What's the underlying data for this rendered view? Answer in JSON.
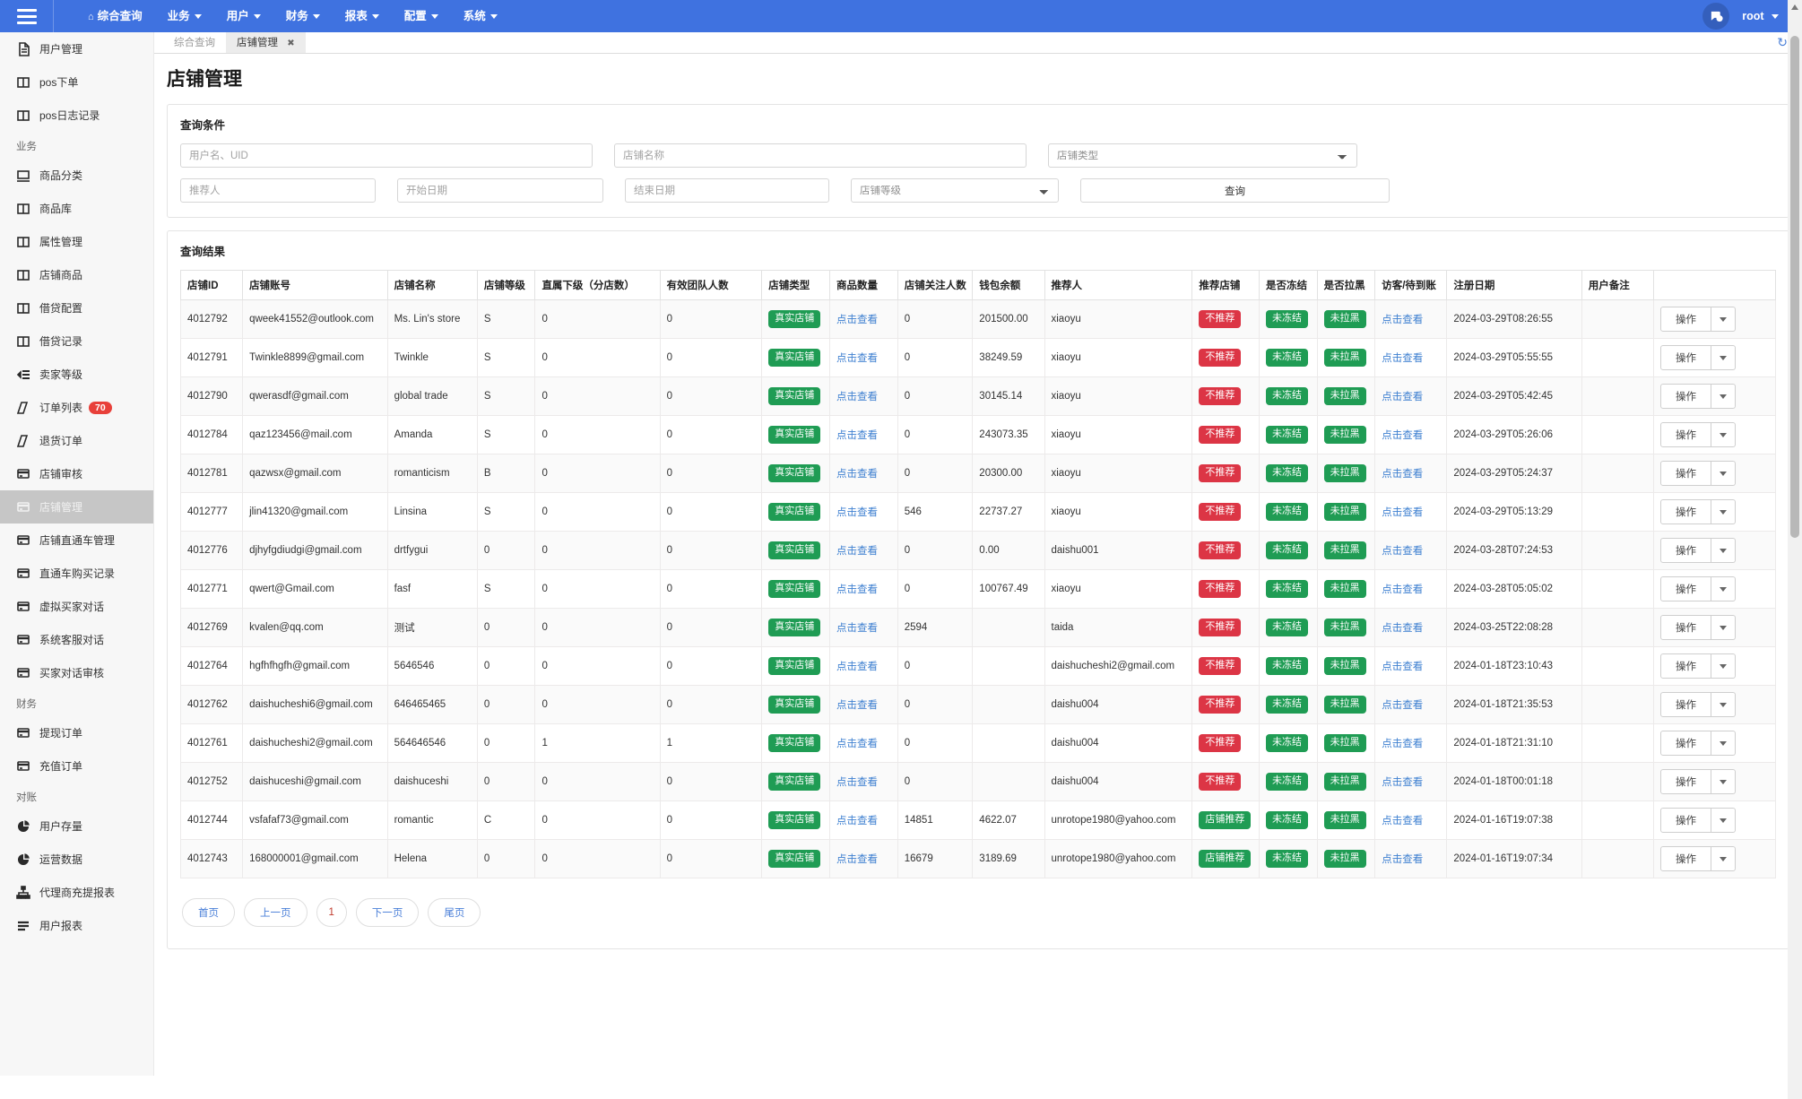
{
  "navbar": {
    "hamburger_icon": "hamburger-icon",
    "items": [
      {
        "label": "综合查询",
        "home": true,
        "caret": false
      },
      {
        "label": "业务",
        "home": false,
        "caret": true
      },
      {
        "label": "用户",
        "home": false,
        "caret": true
      },
      {
        "label": "财务",
        "home": false,
        "caret": true
      },
      {
        "label": "报表",
        "home": false,
        "caret": true
      },
      {
        "label": "配置",
        "home": false,
        "caret": true
      },
      {
        "label": "系统",
        "home": false,
        "caret": true
      }
    ],
    "chat_icon": "chat-bubble-icon",
    "user": "root",
    "brand_color": "#3f72e0"
  },
  "sidebar": {
    "items": [
      {
        "type": "item",
        "label": "用户管理",
        "icon": "document-icon",
        "badge": null,
        "active": false
      },
      {
        "type": "item",
        "label": "pos下单",
        "icon": "columns-icon",
        "badge": null,
        "active": false
      },
      {
        "type": "item",
        "label": "pos日志记录",
        "icon": "columns-icon",
        "badge": null,
        "active": false
      },
      {
        "type": "group",
        "label": "业务"
      },
      {
        "type": "item",
        "label": "商品分类",
        "icon": "monitor-icon",
        "badge": null,
        "active": false
      },
      {
        "type": "item",
        "label": "商品库",
        "icon": "columns-icon",
        "badge": null,
        "active": false
      },
      {
        "type": "item",
        "label": "属性管理",
        "icon": "columns-icon",
        "badge": null,
        "active": false
      },
      {
        "type": "item",
        "label": "店铺商品",
        "icon": "columns-icon",
        "badge": null,
        "active": false
      },
      {
        "type": "item",
        "label": "借贷配置",
        "icon": "columns-icon",
        "badge": null,
        "active": false
      },
      {
        "type": "item",
        "label": "借贷记录",
        "icon": "columns-icon",
        "badge": null,
        "active": false
      },
      {
        "type": "item",
        "label": "卖家等级",
        "icon": "list-icon",
        "badge": null,
        "active": false
      },
      {
        "type": "item",
        "label": "订单列表",
        "icon": "tag-icon",
        "badge": "70",
        "active": false
      },
      {
        "type": "item",
        "label": "退货订单",
        "icon": "tag-icon",
        "badge": null,
        "active": false
      },
      {
        "type": "item",
        "label": "店铺审核",
        "icon": "card-icon",
        "badge": null,
        "active": false
      },
      {
        "type": "item",
        "label": "店铺管理",
        "icon": "card-icon",
        "badge": null,
        "active": true
      },
      {
        "type": "item",
        "label": "店铺直通车管理",
        "icon": "card-icon",
        "badge": null,
        "active": false
      },
      {
        "type": "item",
        "label": "直通车购买记录",
        "icon": "card-icon",
        "badge": null,
        "active": false
      },
      {
        "type": "item",
        "label": "虚拟买家对话",
        "icon": "card-icon",
        "badge": null,
        "active": false
      },
      {
        "type": "item",
        "label": "系统客服对话",
        "icon": "card-icon",
        "badge": null,
        "active": false
      },
      {
        "type": "item",
        "label": "买家对话审核",
        "icon": "card-icon",
        "badge": null,
        "active": false
      },
      {
        "type": "group",
        "label": "财务"
      },
      {
        "type": "item",
        "label": "提现订单",
        "icon": "card-icon",
        "badge": null,
        "active": false
      },
      {
        "type": "item",
        "label": "充值订单",
        "icon": "card-icon",
        "badge": null,
        "active": false
      },
      {
        "type": "group",
        "label": "对账"
      },
      {
        "type": "item",
        "label": "用户存量",
        "icon": "pie-chart-icon",
        "badge": null,
        "active": false
      },
      {
        "type": "item",
        "label": "运营数据",
        "icon": "pie-chart-icon",
        "badge": null,
        "active": false
      },
      {
        "type": "item",
        "label": "代理商充提报表",
        "icon": "sitemap-icon",
        "badge": null,
        "active": false
      },
      {
        "type": "item",
        "label": "用户报表",
        "icon": "bars-icon",
        "badge": null,
        "active": false
      }
    ]
  },
  "tabs": {
    "inactive_label": "综合查询",
    "active_label": "店铺管理",
    "close_glyph": "✖",
    "refresh_icon": "refresh-icon"
  },
  "page": {
    "title": "店铺管理"
  },
  "filters": {
    "panel_title": "查询条件",
    "username_placeholder": "用户名、UID",
    "username_value": "",
    "shopname_placeholder": "店铺名称",
    "shopname_value": "",
    "shoptype_selected": "店铺类型",
    "shoptype_options": [
      "店铺类型"
    ],
    "referrer_placeholder": "推荐人",
    "referrer_value": "",
    "startdate_placeholder": "开始日期",
    "startdate_value": "",
    "enddate_placeholder": "结束日期",
    "enddate_value": "",
    "shoplevel_selected": "店铺等级",
    "shoplevel_options": [
      "店铺等级"
    ],
    "query_button": "查询"
  },
  "results": {
    "panel_title": "查询结果",
    "columns": [
      "店铺ID",
      "店铺账号",
      "店铺名称",
      "店铺等级",
      "直属下级（分店数）",
      "有效团队人数",
      "店铺类型",
      "商品数量",
      "店铺关注人数",
      "钱包余额",
      "推荐人",
      "推荐店铺",
      "是否冻结",
      "是否拉黑",
      "访客/待到账",
      "注册日期",
      "用户备注",
      ""
    ],
    "view_link_label": "点击查看",
    "op_button_label": "操作",
    "rows": [
      {
        "id": "4012792",
        "account": "qweek41552@outlook.com",
        "name": "Ms. Lin's store",
        "level": "S",
        "subs": "0",
        "team": "0",
        "type": "真实店铺",
        "goods": "点击查看",
        "followers": "0",
        "wallet": "201500.00",
        "referrer": "xiaoyu",
        "recommend": "不推荐",
        "recommend_style": "red",
        "frozen": "未冻结",
        "blacklist": "未拉黑",
        "visitor": "点击查看",
        "regdate": "2024-03-29T08:26:55",
        "note": ""
      },
      {
        "id": "4012791",
        "account": "Twinkle8899@gmail.com",
        "name": "Twinkle",
        "level": "S",
        "subs": "0",
        "team": "0",
        "type": "真实店铺",
        "goods": "点击查看",
        "followers": "0",
        "wallet": "38249.59",
        "referrer": "xiaoyu",
        "recommend": "不推荐",
        "recommend_style": "red",
        "frozen": "未冻结",
        "blacklist": "未拉黑",
        "visitor": "点击查看",
        "regdate": "2024-03-29T05:55:55",
        "note": ""
      },
      {
        "id": "4012790",
        "account": "qwerasdf@gmail.com",
        "name": "global trade",
        "level": "S",
        "subs": "0",
        "team": "0",
        "type": "真实店铺",
        "goods": "点击查看",
        "followers": "0",
        "wallet": "30145.14",
        "referrer": "xiaoyu",
        "recommend": "不推荐",
        "recommend_style": "red",
        "frozen": "未冻结",
        "blacklist": "未拉黑",
        "visitor": "点击查看",
        "regdate": "2024-03-29T05:42:45",
        "note": ""
      },
      {
        "id": "4012784",
        "account": "qaz123456@mail.com",
        "name": "Amanda",
        "level": "S",
        "subs": "0",
        "team": "0",
        "type": "真实店铺",
        "goods": "点击查看",
        "followers": "0",
        "wallet": "243073.35",
        "referrer": "xiaoyu",
        "recommend": "不推荐",
        "recommend_style": "red",
        "frozen": "未冻结",
        "blacklist": "未拉黑",
        "visitor": "点击查看",
        "regdate": "2024-03-29T05:26:06",
        "note": ""
      },
      {
        "id": "4012781",
        "account": "qazwsx@gmail.com",
        "name": "romanticism",
        "level": "B",
        "subs": "0",
        "team": "0",
        "type": "真实店铺",
        "goods": "点击查看",
        "followers": "0",
        "wallet": "20300.00",
        "referrer": "xiaoyu",
        "recommend": "不推荐",
        "recommend_style": "red",
        "frozen": "未冻结",
        "blacklist": "未拉黑",
        "visitor": "点击查看",
        "regdate": "2024-03-29T05:24:37",
        "note": ""
      },
      {
        "id": "4012777",
        "account": "jlin41320@gmail.com",
        "name": "Linsina",
        "level": "S",
        "subs": "0",
        "team": "0",
        "type": "真实店铺",
        "goods": "点击查看",
        "followers": "546",
        "wallet": "22737.27",
        "referrer": "xiaoyu",
        "recommend": "不推荐",
        "recommend_style": "red",
        "frozen": "未冻结",
        "blacklist": "未拉黑",
        "visitor": "点击查看",
        "regdate": "2024-03-29T05:13:29",
        "note": ""
      },
      {
        "id": "4012776",
        "account": "djhyfgdiudgi@gmail.com",
        "name": "drtfygui",
        "level": "0",
        "subs": "0",
        "team": "0",
        "type": "真实店铺",
        "goods": "点击查看",
        "followers": "0",
        "wallet": "0.00",
        "referrer": "daishu001",
        "recommend": "不推荐",
        "recommend_style": "red",
        "frozen": "未冻结",
        "blacklist": "未拉黑",
        "visitor": "点击查看",
        "regdate": "2024-03-28T07:24:53",
        "note": ""
      },
      {
        "id": "4012771",
        "account": "qwert@Gmail.com",
        "name": "fasf",
        "level": "S",
        "subs": "0",
        "team": "0",
        "type": "真实店铺",
        "goods": "点击查看",
        "followers": "0",
        "wallet": "100767.49",
        "referrer": "xiaoyu",
        "recommend": "不推荐",
        "recommend_style": "red",
        "frozen": "未冻结",
        "blacklist": "未拉黑",
        "visitor": "点击查看",
        "regdate": "2024-03-28T05:05:02",
        "note": ""
      },
      {
        "id": "4012769",
        "account": "kvalen@qq.com",
        "name": "测试",
        "level": "0",
        "subs": "0",
        "team": "0",
        "type": "真实店铺",
        "goods": "点击查看",
        "followers": "2594",
        "wallet": "",
        "referrer": "taida",
        "recommend": "不推荐",
        "recommend_style": "red",
        "frozen": "未冻结",
        "blacklist": "未拉黑",
        "visitor": "点击查看",
        "regdate": "2024-03-25T22:08:28",
        "note": ""
      },
      {
        "id": "4012764",
        "account": "hgfhfhgfh@gmail.com",
        "name": "5646546",
        "level": "0",
        "subs": "0",
        "team": "0",
        "type": "真实店铺",
        "goods": "点击查看",
        "followers": "0",
        "wallet": "",
        "referrer": "daishucheshi2@gmail.com",
        "recommend": "不推荐",
        "recommend_style": "red",
        "frozen": "未冻结",
        "blacklist": "未拉黑",
        "visitor": "点击查看",
        "regdate": "2024-01-18T23:10:43",
        "note": ""
      },
      {
        "id": "4012762",
        "account": "daishucheshi6@gmail.com",
        "name": "646465465",
        "level": "0",
        "subs": "0",
        "team": "0",
        "type": "真实店铺",
        "goods": "点击查看",
        "followers": "0",
        "wallet": "",
        "referrer": "daishu004",
        "recommend": "不推荐",
        "recommend_style": "red",
        "frozen": "未冻结",
        "blacklist": "未拉黑",
        "visitor": "点击查看",
        "regdate": "2024-01-18T21:35:53",
        "note": ""
      },
      {
        "id": "4012761",
        "account": "daishucheshi2@gmail.com",
        "name": "564646546",
        "level": "0",
        "subs": "1",
        "team": "1",
        "type": "真实店铺",
        "goods": "点击查看",
        "followers": "0",
        "wallet": "",
        "referrer": "daishu004",
        "recommend": "不推荐",
        "recommend_style": "red",
        "frozen": "未冻结",
        "blacklist": "未拉黑",
        "visitor": "点击查看",
        "regdate": "2024-01-18T21:31:10",
        "note": ""
      },
      {
        "id": "4012752",
        "account": "daishuceshi@gmail.com",
        "name": "daishuceshi",
        "level": "0",
        "subs": "0",
        "team": "0",
        "type": "真实店铺",
        "goods": "点击查看",
        "followers": "0",
        "wallet": "",
        "referrer": "daishu004",
        "recommend": "不推荐",
        "recommend_style": "red",
        "frozen": "未冻结",
        "blacklist": "未拉黑",
        "visitor": "点击查看",
        "regdate": "2024-01-18T00:01:18",
        "note": ""
      },
      {
        "id": "4012744",
        "account": "vsfafaf73@gmail.com",
        "name": "romantic",
        "level": "C",
        "subs": "0",
        "team": "0",
        "type": "真实店铺",
        "goods": "点击查看",
        "followers": "14851",
        "wallet": "4622.07",
        "referrer": "unrotope1980@yahoo.com",
        "recommend": "店铺推荐",
        "recommend_style": "green",
        "frozen": "未冻结",
        "blacklist": "未拉黑",
        "visitor": "点击查看",
        "regdate": "2024-01-16T19:07:38",
        "note": ""
      },
      {
        "id": "4012743",
        "account": "168000001@gmail.com",
        "name": "Helena",
        "level": "0",
        "subs": "0",
        "team": "0",
        "type": "真实店铺",
        "goods": "点击查看",
        "followers": "16679",
        "wallet": "3189.69",
        "referrer": "unrotope1980@yahoo.com",
        "recommend": "店铺推荐",
        "recommend_style": "green",
        "frozen": "未冻结",
        "blacklist": "未拉黑",
        "visitor": "点击查看",
        "regdate": "2024-01-16T19:07:34",
        "note": ""
      }
    ]
  },
  "pagination": {
    "first": "首页",
    "prev": "上一页",
    "current": "1",
    "next": "下一页",
    "last": "尾页"
  },
  "colors": {
    "brand": "#3f72e0",
    "success": "#1f9c54",
    "danger": "#dc3545",
    "link": "#3d7fd0",
    "badge": "#e8403a"
  }
}
